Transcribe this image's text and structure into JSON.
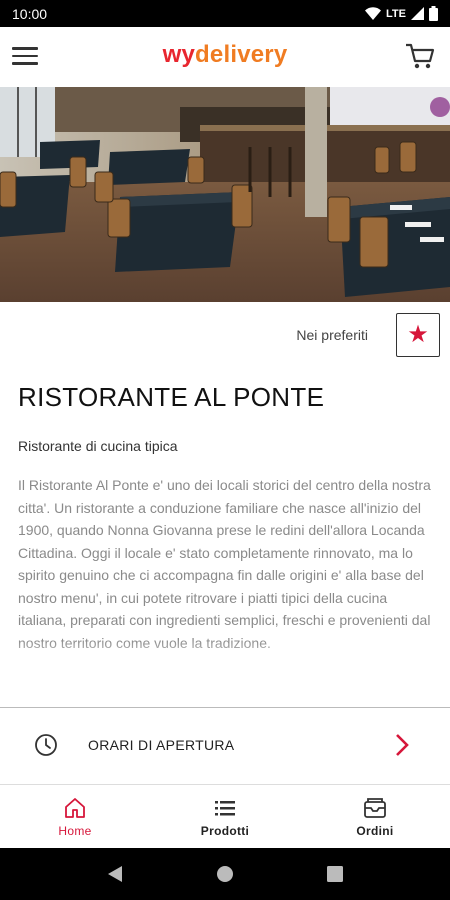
{
  "status_bar": {
    "time": "10:00",
    "network": "LTE"
  },
  "app_bar": {
    "logo_part1": "wy",
    "logo_part2": "delivery"
  },
  "colors": {
    "accent": "#d6163a",
    "logo_red": "#e8262f",
    "logo_orange": "#f07c22"
  },
  "restaurant": {
    "favorite_label": "Nei preferiti",
    "name": "RISTORANTE AL PONTE",
    "subtitle": "Ristorante di cucina tipica",
    "description": "Il Ristorante Al Ponte e' uno dei locali storici del centro della nostra citta'. Un ristorante a conduzione familiare che nasce all'inizio del 1900, quando Nonna Giovanna prese le redini dell'allora Locanda Cittadina. Oggi il locale e' stato completamente rinnovato, ma lo spirito genuino che ci accompagna fin dalle origini e' alla base del nostro menu', in cui potete ritrovare i piatti tipici della cucina italiana, preparati con ingredienti semplici, freschi e provenienti dal nostro territorio come vuole la tradizione."
  },
  "opening_hours": {
    "label": "ORARI DI APERTURA"
  },
  "bottom_nav": {
    "items": [
      {
        "label": "Home",
        "icon": "home-icon",
        "active": true
      },
      {
        "label": "Prodotti",
        "icon": "list-icon",
        "active": false
      },
      {
        "label": "Ordini",
        "icon": "orders-icon",
        "active": false
      }
    ]
  },
  "icons": {
    "menu": "hamburger-menu-icon",
    "cart": "cart-icon",
    "favorite": "star-icon",
    "clock": "clock-icon",
    "chevron": "chevron-right-icon"
  }
}
